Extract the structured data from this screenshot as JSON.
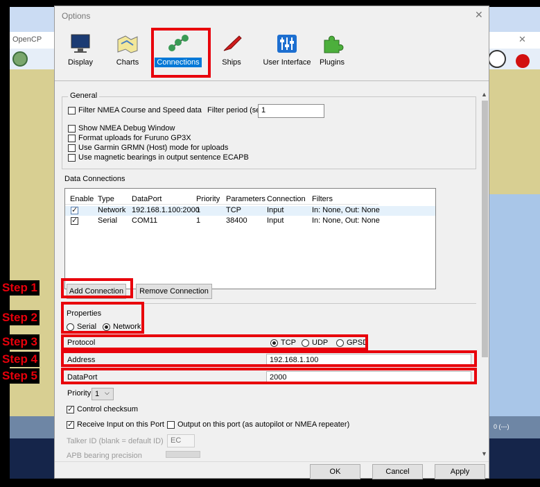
{
  "background_app": {
    "title": "OpenCP",
    "status_text": "0 (---)"
  },
  "dialog": {
    "title": "Options",
    "close_glyph": "✕",
    "toolbar": [
      {
        "label": "Display",
        "icon": "monitor-icon"
      },
      {
        "label": "Charts",
        "icon": "chart-icon"
      },
      {
        "label": "Connections",
        "icon": "network-icon"
      },
      {
        "label": "Ships",
        "icon": "ship-icon"
      },
      {
        "label": "User Interface",
        "icon": "sliders-icon"
      },
      {
        "label": "Plugins",
        "icon": "puzzle-icon"
      }
    ],
    "general": {
      "title": "General",
      "filter_label": "Filter NMEA Course and Speed data",
      "filter_period_label": "Filter period (sec)",
      "filter_period_value": "1",
      "options": [
        "Show NMEA Debug Window",
        "Format uploads for Furuno GP3X",
        "Use Garmin GRMN (Host) mode for uploads",
        "Use magnetic bearings in output sentence ECAPB"
      ]
    },
    "data_connections": {
      "title": "Data Connections",
      "columns": [
        "Enable",
        "Type",
        "DataPort",
        "Priority",
        "Parameters",
        "Connection",
        "Filters"
      ],
      "rows": [
        {
          "type": "Network",
          "dataport": "192.168.1.100:2000",
          "priority": "1",
          "parameters": "TCP",
          "connection": "Input",
          "filters": "In: None, Out: None"
        },
        {
          "type": "Serial",
          "dataport": "COM11",
          "priority": "1",
          "parameters": "38400",
          "connection": "Input",
          "filters": "In: None, Out: None"
        }
      ],
      "add_label": "Add Connection",
      "remove_label": "Remove Connection"
    },
    "properties": {
      "title": "Properties",
      "serial_label": "Serial",
      "network_label": "Network",
      "protocol_label": "Protocol",
      "tcp_label": "TCP",
      "udp_label": "UDP",
      "gpsd_label": "GPSD",
      "address_label": "Address",
      "address_value": "192.168.1.100",
      "dataport_label": "DataPort",
      "dataport_value": "2000",
      "priority_label": "Priority",
      "priority_value": "1",
      "control_checksum_label": "Control checksum",
      "receive_input_label": "Receive Input on this Port",
      "output_label": "Output on this port (as autopilot or NMEA repeater)",
      "talker_label": "Talker ID (blank = default ID)",
      "talker_value": "EC",
      "apb_label": "APB bearing precision"
    },
    "buttons": {
      "ok": "OK",
      "cancel": "Cancel",
      "apply": "Apply"
    }
  },
  "steps": [
    "Step 1",
    "Step 2",
    "Step 3",
    "Step 4",
    "Step 5"
  ],
  "colors": {
    "annotation_red": "#e8000b",
    "selected_blue": "#0078d7"
  }
}
